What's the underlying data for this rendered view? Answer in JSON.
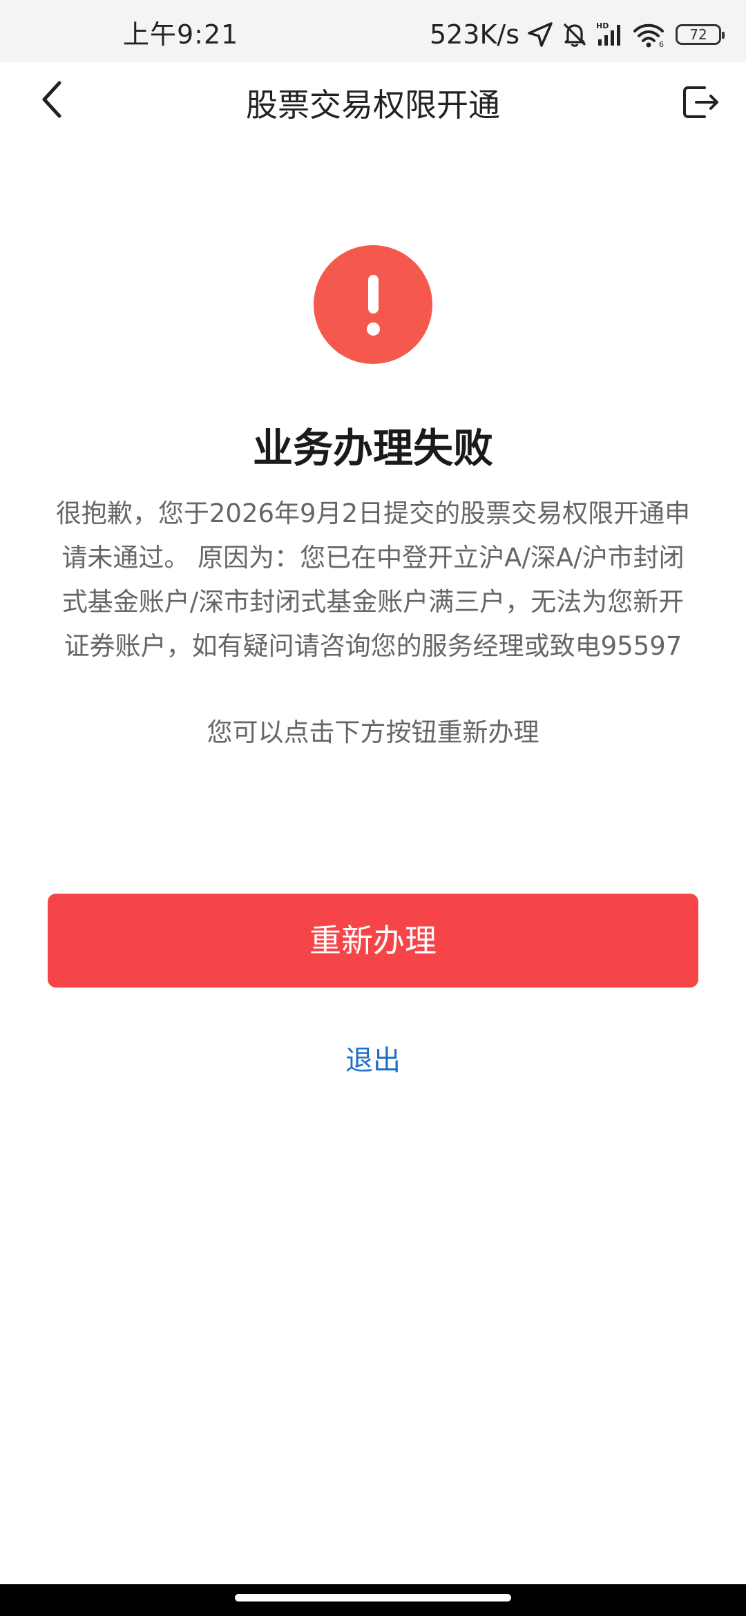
{
  "status_bar": {
    "time": "上午9:21",
    "net_speed": "523K/s",
    "battery": "72",
    "icons": [
      "location-icon",
      "mute-bell-icon",
      "hd-signal-icon",
      "wifi-icon",
      "battery-icon"
    ]
  },
  "nav": {
    "title": "股票交易权限开通",
    "back_icon": "chevron-left-icon",
    "exit_icon": "logout-icon"
  },
  "result": {
    "icon": "exclamation-icon",
    "icon_color": "#f5594e",
    "title": "业务办理失败",
    "description": "很抱歉，您于2026年9月2日提交的股票交易权限开通申请未通过。 原因为：您已在中登开立沪A/深A/沪市封闭式基金账户/深市封闭式基金账户满三户，无法为您新开证券账户，如有疑问请咨询您的服务经理或致电95597",
    "hint": "您可以点击下方按钮重新办理"
  },
  "actions": {
    "retry_label": "重新办理",
    "retry_color": "#f54548",
    "exit_label": "退出",
    "exit_color": "#1e6fc8"
  }
}
